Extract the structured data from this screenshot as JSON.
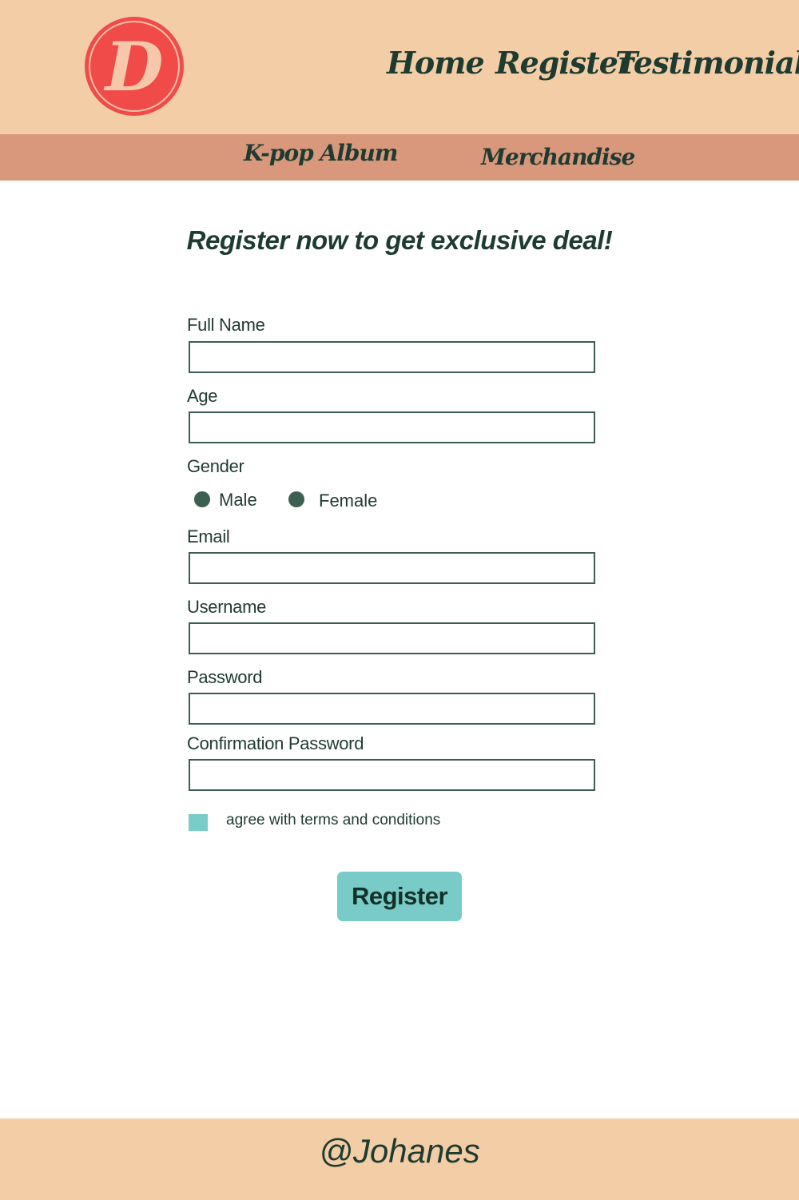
{
  "header": {
    "logo_letter": "D",
    "nav": {
      "home": "Home",
      "register": "Register",
      "testimonial": "Testimonial"
    }
  },
  "subnav": {
    "kpop_album": "K-pop Album",
    "merchandise": "Merchandise"
  },
  "main": {
    "headline": "Register now to get exclusive deal!",
    "form": {
      "full_name": {
        "label": "Full Name",
        "value": ""
      },
      "age": {
        "label": "Age",
        "value": ""
      },
      "gender": {
        "label": "Gender",
        "options": [
          "Male",
          "Female"
        ]
      },
      "email": {
        "label": "Email",
        "value": ""
      },
      "username": {
        "label": "Username",
        "value": ""
      },
      "password": {
        "label": "Password",
        "value": ""
      },
      "confirmation_password": {
        "label": "Confirmation Password",
        "value": ""
      },
      "terms": {
        "label": "agree with terms and conditions"
      },
      "submit_label": "Register"
    }
  },
  "footer": {
    "text": "@Johanes"
  },
  "colors": {
    "header_bg": "#f3cda5",
    "subnav_bg": "#d9977b",
    "logo_red": "#f04b49",
    "text_dark_green": "#1e3b32",
    "field_border": "#3c5e52",
    "accent_teal": "#78cbc6"
  }
}
